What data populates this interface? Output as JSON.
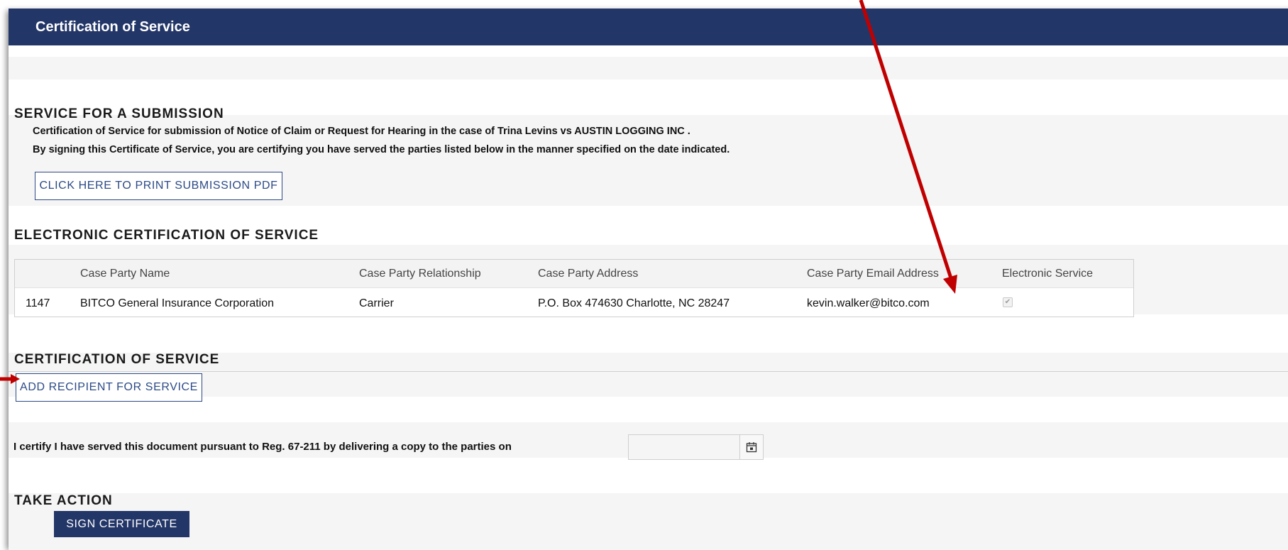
{
  "header": {
    "title": "Certification of Service"
  },
  "submission": {
    "heading": "SERVICE FOR A SUBMISSION",
    "line1": "Certification of Service for submission of Notice of Claim or Request for Hearing in the case of Trina Levins vs AUSTIN LOGGING INC .",
    "line2": "By signing this Certificate of Service, you are certifying you have served the parties listed below in the manner specified on the date indicated.",
    "print_button": "CLICK HERE TO PRINT SUBMISSION PDF"
  },
  "electronic": {
    "heading": "ELECTRONIC CERTIFICATION OF SERVICE",
    "columns": [
      "Case Party Name",
      "Case Party Relationship",
      "Case Party Address",
      "Case Party Email Address",
      "Electronic Service"
    ],
    "rows": [
      {
        "id": "1147",
        "name": "BITCO General Insurance Corporation",
        "relationship": "Carrier",
        "address": "P.O. Box 474630 Charlotte, NC 28247",
        "email": "kevin.walker@bitco.com",
        "electronic_service": true
      }
    ]
  },
  "certification": {
    "heading": "CERTIFICATION OF SERVICE",
    "add_button": "ADD RECIPIENT FOR SERVICE",
    "certify_text": "I certify I have served this document pursuant to Reg. 67-211 by delivering a copy to the parties on",
    "date_value": ""
  },
  "action": {
    "heading": "TAKE ACTION",
    "sign_button": "SIGN CERTIFICATE"
  },
  "colors": {
    "header_bg": "#233668",
    "arrow": "#c00000",
    "button_border": "#2c4a86"
  },
  "icons": {
    "date_picker": "calendar-icon",
    "checkbox": "checkmark-icon"
  }
}
